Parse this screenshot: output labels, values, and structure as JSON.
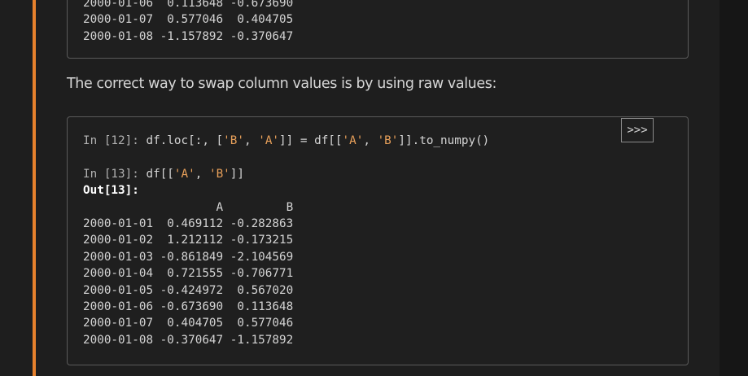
{
  "top_output": {
    "lines": [
      "2000-01-06  0.113648 -0.673690",
      "2000-01-07  0.577046  0.404705",
      "2000-01-08 -1.157892 -0.370647"
    ]
  },
  "prose": {
    "text": "The correct way to swap column values is by using raw values:"
  },
  "main_block": {
    "copy_button_label": ">>>",
    "in12_prompt": "In [12]:",
    "in12_code_pre": " df.loc[:, [",
    "in12_str_b": "'B'",
    "in12_sep1": ", ",
    "in12_str_a": "'A'",
    "in12_code_mid": "]] = df[[",
    "in12_str_a2": "'A'",
    "in12_sep2": ", ",
    "in12_str_b2": "'B'",
    "in12_code_post": "]].to_numpy()",
    "in13_prompt": "In [13]:",
    "in13_code_pre": " df[[",
    "in13_str_a": "'A'",
    "in13_sep": ", ",
    "in13_str_b": "'B'",
    "in13_code_post": "]]",
    "out13_prompt": "Out[13]:",
    "table_header": "                   A         B",
    "table_rows": [
      "2000-01-01  0.469112 -0.282863",
      "2000-01-02  1.212112 -0.173215",
      "2000-01-03 -0.861849 -2.104569",
      "2000-01-04  0.721555 -0.706771",
      "2000-01-05 -0.424972  0.567020",
      "2000-01-06 -0.673690  0.113648",
      "2000-01-07  0.404705  0.577046",
      "2000-01-08 -0.370647 -1.157892"
    ]
  },
  "colors": {
    "accent": "#e7812d",
    "string": "#e8a05a",
    "background": "#1e1e1e"
  }
}
